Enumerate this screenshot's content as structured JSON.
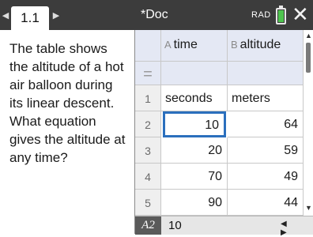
{
  "titlebar": {
    "tab_label": "1.1",
    "nav_left_icon": "◀",
    "nav_right_icon": "▶",
    "doc_title": "*Doc",
    "angle_mode": "RAD",
    "close_icon": "✕"
  },
  "question": {
    "text": "The table shows the altitude of a hot air balloon during its linear descent. What equation gives the altitude at any time?"
  },
  "sheet": {
    "columns": [
      {
        "letter": "A",
        "name": "time"
      },
      {
        "letter": "B",
        "name": "altitude"
      }
    ],
    "formula_row_symbol": "=",
    "rows": [
      {
        "num": "1",
        "a": "seconds",
        "b": "meters"
      },
      {
        "num": "2",
        "a": "10",
        "b": "64"
      },
      {
        "num": "3",
        "a": "20",
        "b": "59"
      },
      {
        "num": "4",
        "a": "70",
        "b": "49"
      },
      {
        "num": "5",
        "a": "90",
        "b": "44"
      }
    ],
    "selected_cell": "A2",
    "entry_value": "10",
    "entry_arrows": "◀ ▶",
    "scroll_up": "▲",
    "scroll_down": "▼"
  },
  "colors": {
    "titlebar": "#3c3c3c",
    "header": "#e4e8f4",
    "selection": "#2b6fbd",
    "battery": "#4ec44e"
  }
}
